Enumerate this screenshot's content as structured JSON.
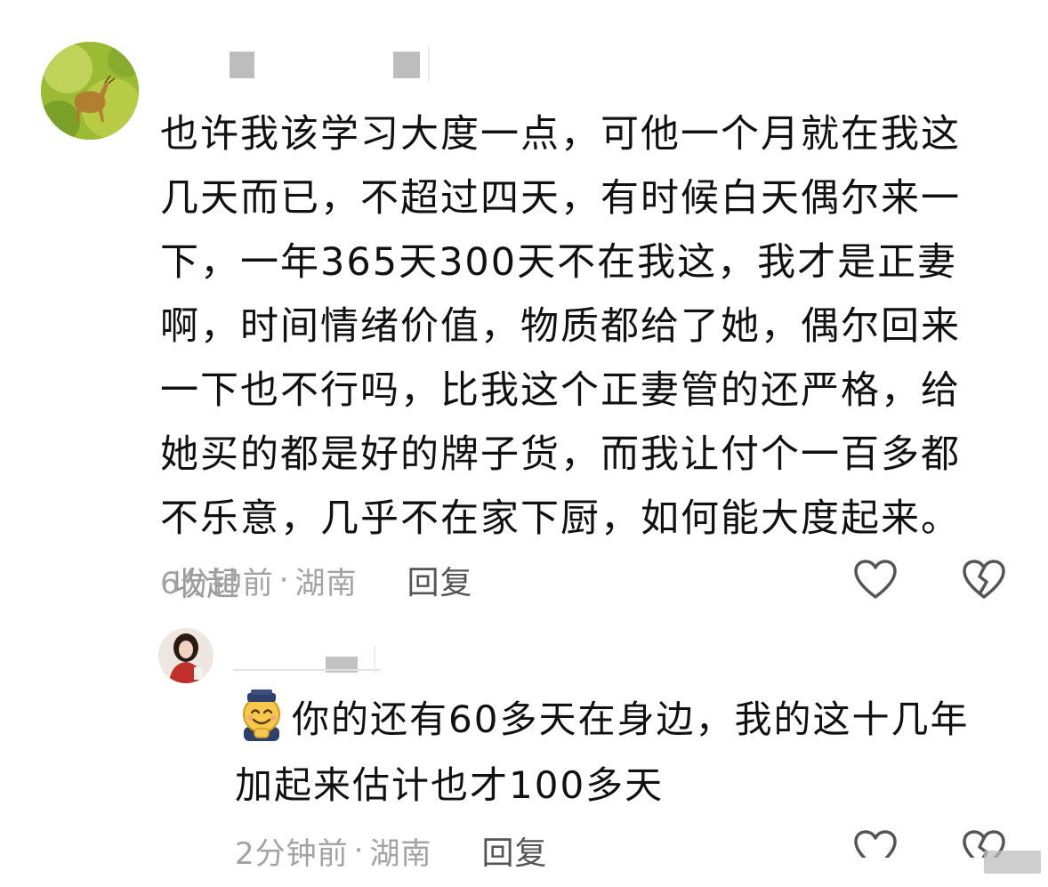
{
  "comment": {
    "text": "也许我该学习大度一点，可他一个月就在我这几天而已，不超过四天，有时候白天偶尔来一下，一年365天300天不在我这，我才是正妻啊，时间情绪价值，物质都给了她，偶尔回来一下也不行吗，比我这个正妻管的还严格，给她买的都是好的牌子货，而我让付个一百多都不乐意，几乎不在家下厨，如何能大度起来。",
    "collapse_label": "收起",
    "time": "6分钟前",
    "separator": "·",
    "location": "湖南",
    "reply_label": "回复",
    "like_icon": "heart-outline-icon",
    "dislike_icon": "broken-heart-icon"
  },
  "reply": {
    "emoji": "smiling-face-icon",
    "text": "你的还有60多天在身边，我的这十几年加起来估计也才100多天",
    "time": "2分钟前",
    "separator": "·",
    "location": "湖南",
    "reply_label": "回复"
  },
  "colors": {
    "text": "#111111",
    "meta": "#a3a3a3",
    "reply_action": "#555555",
    "icon_stroke": "#555555"
  }
}
